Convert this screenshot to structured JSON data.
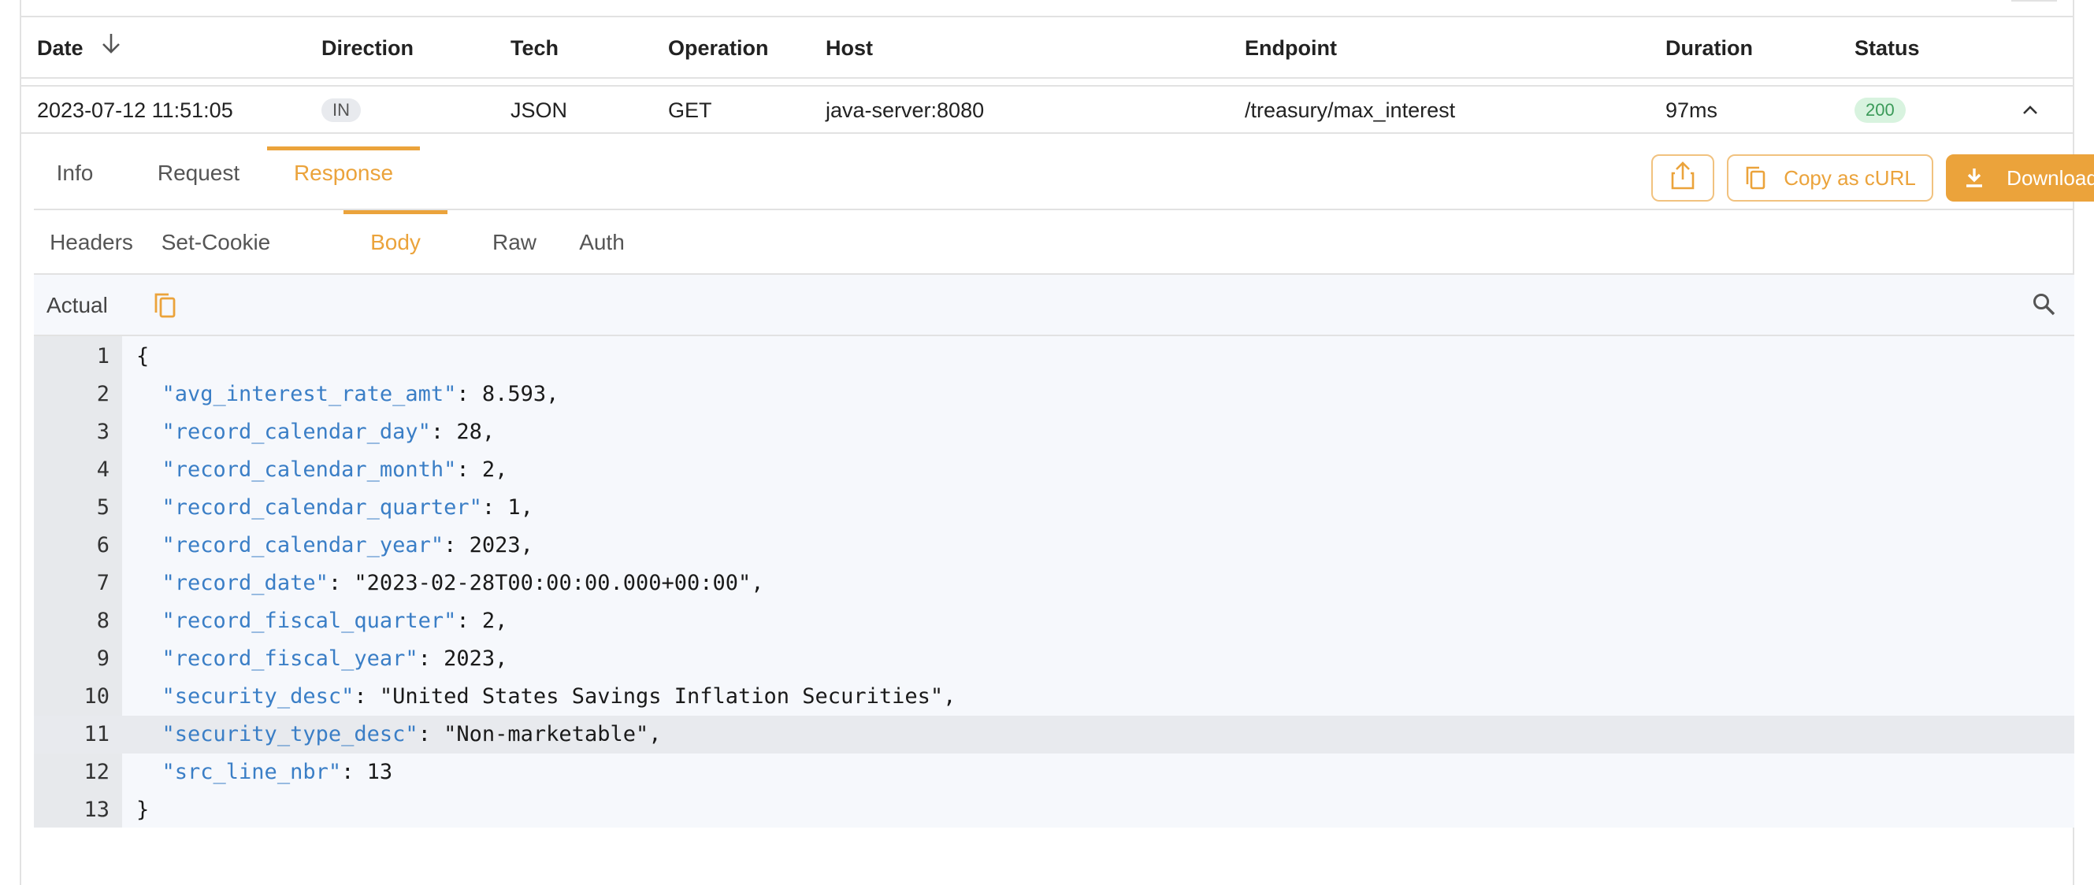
{
  "table": {
    "headers": {
      "date": "Date",
      "direction": "Direction",
      "tech": "Tech",
      "operation": "Operation",
      "host": "Host",
      "endpoint": "Endpoint",
      "duration": "Duration",
      "status": "Status"
    },
    "row": {
      "date": "2023-07-12 11:51:05",
      "direction": "IN",
      "tech": "JSON",
      "operation": "GET",
      "host": "java-server:8080",
      "endpoint": "/treasury/max_interest",
      "duration": "97ms",
      "status": "200"
    }
  },
  "tabs": {
    "main": [
      "Info",
      "Request",
      "Response"
    ],
    "main_active": "Response",
    "sub": [
      "Headers",
      "Set-Cookie",
      "Body",
      "Raw",
      "Auth"
    ],
    "sub_active": "Body"
  },
  "buttons": {
    "copy_curl": "Copy as cURL",
    "download": "Download"
  },
  "body": {
    "label": "Actual"
  },
  "code": {
    "lines": [
      {
        "n": "1",
        "pre": "{",
        "key": "",
        "post": ""
      },
      {
        "n": "2",
        "pre": "  ",
        "key": "\"avg_interest_rate_amt\"",
        "post": ": 8.593,"
      },
      {
        "n": "3",
        "pre": "  ",
        "key": "\"record_calendar_day\"",
        "post": ": 28,"
      },
      {
        "n": "4",
        "pre": "  ",
        "key": "\"record_calendar_month\"",
        "post": ": 2,"
      },
      {
        "n": "5",
        "pre": "  ",
        "key": "\"record_calendar_quarter\"",
        "post": ": 1,"
      },
      {
        "n": "6",
        "pre": "  ",
        "key": "\"record_calendar_year\"",
        "post": ": 2023,"
      },
      {
        "n": "7",
        "pre": "  ",
        "key": "\"record_date\"",
        "post": ": \"2023-02-28T00:00:00.000+00:00\","
      },
      {
        "n": "8",
        "pre": "  ",
        "key": "\"record_fiscal_quarter\"",
        "post": ": 2,"
      },
      {
        "n": "9",
        "pre": "  ",
        "key": "\"record_fiscal_year\"",
        "post": ": 2023,"
      },
      {
        "n": "10",
        "pre": "  ",
        "key": "\"security_desc\"",
        "post": ": \"United States Savings Inflation Securities\","
      },
      {
        "n": "11",
        "pre": "  ",
        "key": "\"security_type_desc\"",
        "post": ": \"Non-marketable\","
      },
      {
        "n": "12",
        "pre": "  ",
        "key": "\"src_line_nbr\"",
        "post": ": 13"
      },
      {
        "n": "13",
        "pre": "}",
        "key": "",
        "post": ""
      }
    ],
    "highlighted_line": "11"
  },
  "colors": {
    "accent": "#eba33b",
    "json_key": "#3a7ec6",
    "status_ok_bg": "#d8f3df",
    "status_ok_fg": "#3a9a58"
  }
}
